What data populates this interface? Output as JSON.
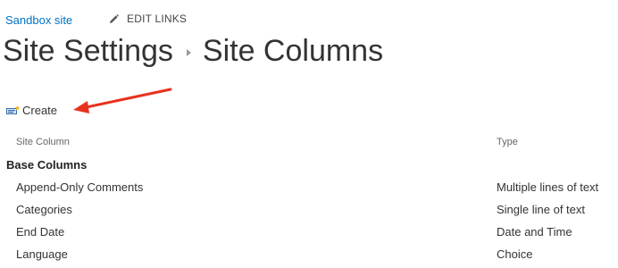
{
  "nav": {
    "site_link": "Sandbox site",
    "edit_links": "EDIT LINKS"
  },
  "title": {
    "parent": "Site Settings",
    "current": "Site Columns"
  },
  "toolbar": {
    "create_label": "Create"
  },
  "columns": {
    "site_column": "Site Column",
    "type": "Type"
  },
  "groups": [
    {
      "title": "Base Columns",
      "rows": [
        {
          "name": "Append-Only Comments",
          "type": "Multiple lines of text"
        },
        {
          "name": "Categories",
          "type": "Single line of text"
        },
        {
          "name": "End Date",
          "type": "Date and Time"
        },
        {
          "name": "Language",
          "type": "Choice"
        }
      ]
    }
  ],
  "colors": {
    "link": "#0072c6",
    "annotation_arrow": "#e8321e"
  }
}
